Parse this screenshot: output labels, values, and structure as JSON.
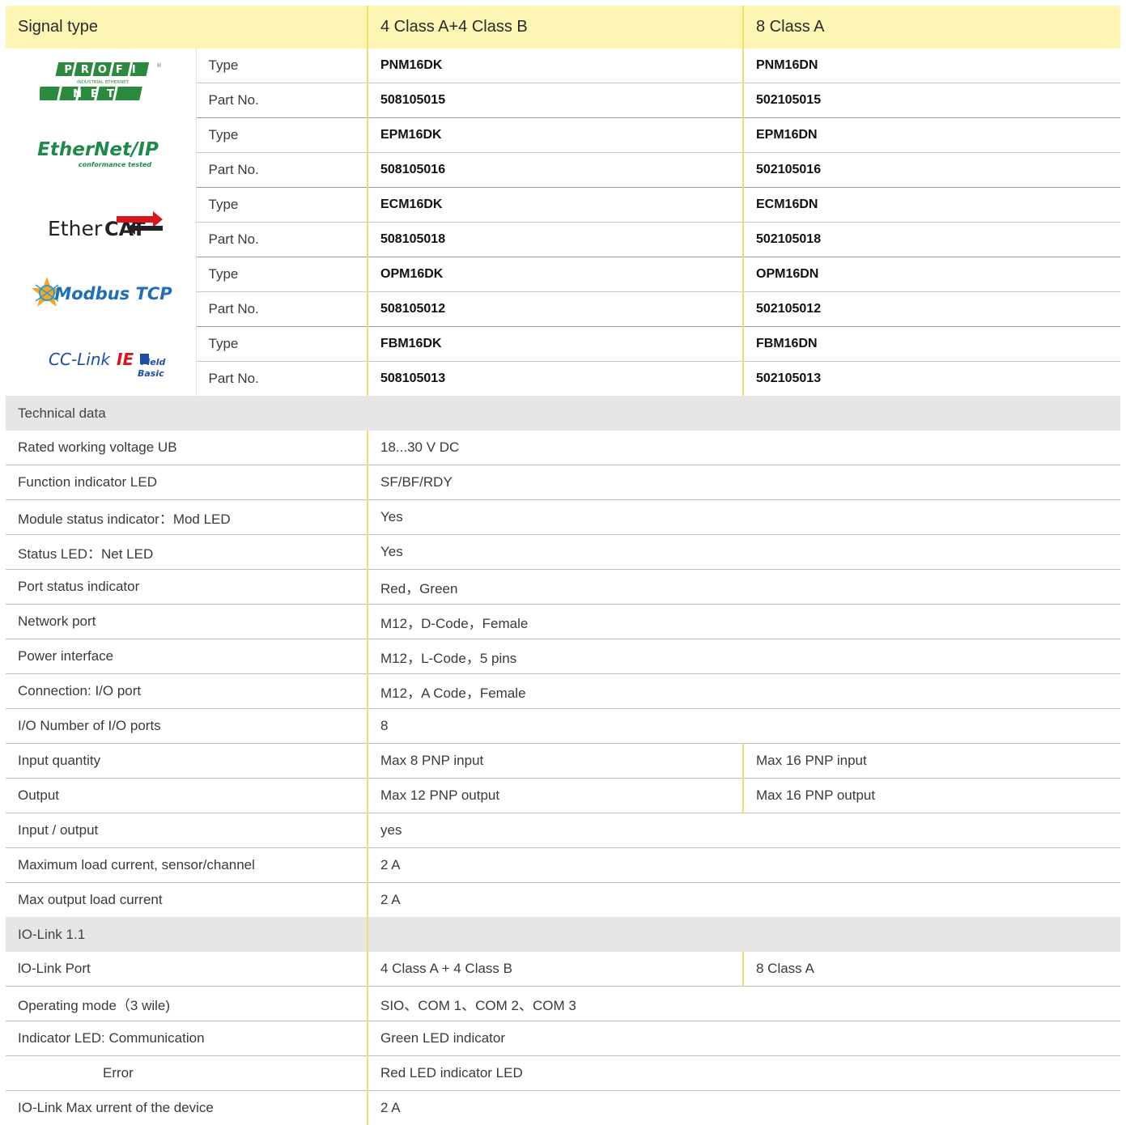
{
  "header": {
    "signal_type": "Signal type",
    "col_b": "4 Class A+4 Class B",
    "col_a": "8 Class A"
  },
  "protocols": [
    {
      "logo": "profinet-logo",
      "logo_text": [
        "PROFI",
        "INDUSTRIAL ETHERNET",
        "NET"
      ],
      "type_label": "Type",
      "part_label": "Part No.",
      "type_b": "PNM16DK",
      "type_a": "PNM16DN",
      "part_b": "508105015",
      "part_a": "502105015"
    },
    {
      "logo": "ethernet-ip-logo",
      "logo_text": [
        "EtherNet/IP",
        "conformance tested"
      ],
      "type_label": "Type",
      "part_label": "Part No.",
      "type_b": "EPM16DK",
      "type_a": "EPM16DN",
      "part_b": "508105016",
      "part_a": "502105016"
    },
    {
      "logo": "ethercat-logo",
      "logo_text": [
        "Ether",
        "CAT"
      ],
      "type_label": "Type",
      "part_label": "Part No.",
      "type_b": "ECM16DK",
      "type_a": "ECM16DN",
      "part_b": "508105018",
      "part_a": "502105018"
    },
    {
      "logo": "modbus-tcp-logo",
      "logo_text": [
        "Modbus TCP"
      ],
      "type_label": "Type",
      "part_label": "Part No.",
      "type_b": "OPM16DK",
      "type_a": "OPM16DN",
      "part_b": "508105012",
      "part_a": "502105012"
    },
    {
      "logo": "cc-link-ie-field-basic-logo",
      "logo_text": [
        "CC-Link",
        "IE",
        "Field",
        "Basic"
      ],
      "type_label": "Type",
      "part_label": "Part No.",
      "type_b": "FBM16DK",
      "type_a": "FBM16DN",
      "part_b": "508105013",
      "part_a": "502105013"
    }
  ],
  "technical": {
    "section_title": "Technical data",
    "rows": [
      {
        "label": "Rated working voltage UB",
        "value": "18...30 V DC"
      },
      {
        "label": "Function indicator LED",
        "value": "SF/BF/RDY"
      },
      {
        "label": "Module status indicator：Mod LED",
        "value": "Yes"
      },
      {
        "label": "Status LED：Net LED",
        "value": "Yes"
      },
      {
        "label": "Port status indicator",
        "value": "Red，Green"
      },
      {
        "label": "Network port",
        "value": "M12，D-Code，Female"
      },
      {
        "label": "Power interface",
        "value": "M12，L-Code，5 pins"
      },
      {
        "label": "Connection: I/O port",
        "value": "M12，A Code，Female"
      },
      {
        "label": "I/O Number of I/O ports",
        "value": "8"
      },
      {
        "label": "Input quantity",
        "value_b": "Max 8 PNP input",
        "value_a": "Max 16 PNP input"
      },
      {
        "label": "Output",
        "value_b": "Max 12 PNP output",
        "value_a": "Max 16 PNP output"
      },
      {
        "label": "Input / output",
        "value": "yes"
      },
      {
        "label": "Maximum load current, sensor/channel",
        "value": "2 A"
      },
      {
        "label": "Max output load current",
        "value": "2 A"
      }
    ]
  },
  "iolink": {
    "section_title": "IO-Link 1.1",
    "rows": [
      {
        "label": "lO-Link Port",
        "value_b": "4 Class A + 4 Class B",
        "value_a": "8 Class A"
      },
      {
        "label": "Operating mode（3 wile)",
        "value": "SIO、COM 1、COM 2、COM 3"
      },
      {
        "label": "Indicator LED: Communication",
        "value": "Green LED indicator"
      },
      {
        "label": "Error",
        "value": "Red LED indicator LED",
        "indent": true
      },
      {
        "label": "IO-Link Max urrent of the device",
        "value": "2 A"
      }
    ]
  },
  "colors": {
    "header_bg": "#fdf5b4",
    "divider_yellow": "#f4dc6a",
    "section_bg": "#e6e6e6",
    "profinet_green": "#2b8a3e",
    "ethernetip_green": "#1d8a4a",
    "ethercat_red": "#d9161c",
    "modbus_blue": "#1f6fb8",
    "cclink_blue": "#1c4ea8"
  }
}
